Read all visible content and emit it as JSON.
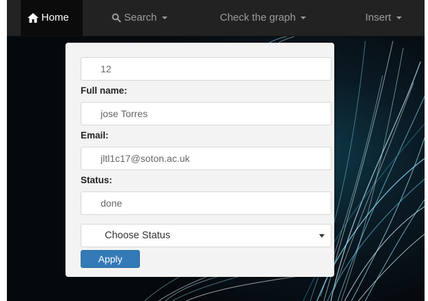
{
  "navbar": {
    "items": [
      {
        "label": "Home",
        "icon": "home-icon",
        "active": true
      },
      {
        "label": "Search",
        "icon": "search-icon",
        "dropdown": true
      },
      {
        "label": "Check the graph",
        "dropdown": true
      },
      {
        "label": "Insert",
        "dropdown": true
      }
    ]
  },
  "form": {
    "id_value": "12",
    "full_name_label": "Full name:",
    "full_name_value": "jose Torres",
    "email_label": "Email:",
    "email_value": "jltl1c17@soton.ac.uk",
    "status_label": "Status:",
    "status_value": "done",
    "status_select": "Choose Status",
    "apply_label": "Apply"
  },
  "colors": {
    "navbar": "#222222",
    "active_item": "#0b0b0b",
    "panel": "#f3f3f3",
    "primary_button": "#337ab7"
  }
}
